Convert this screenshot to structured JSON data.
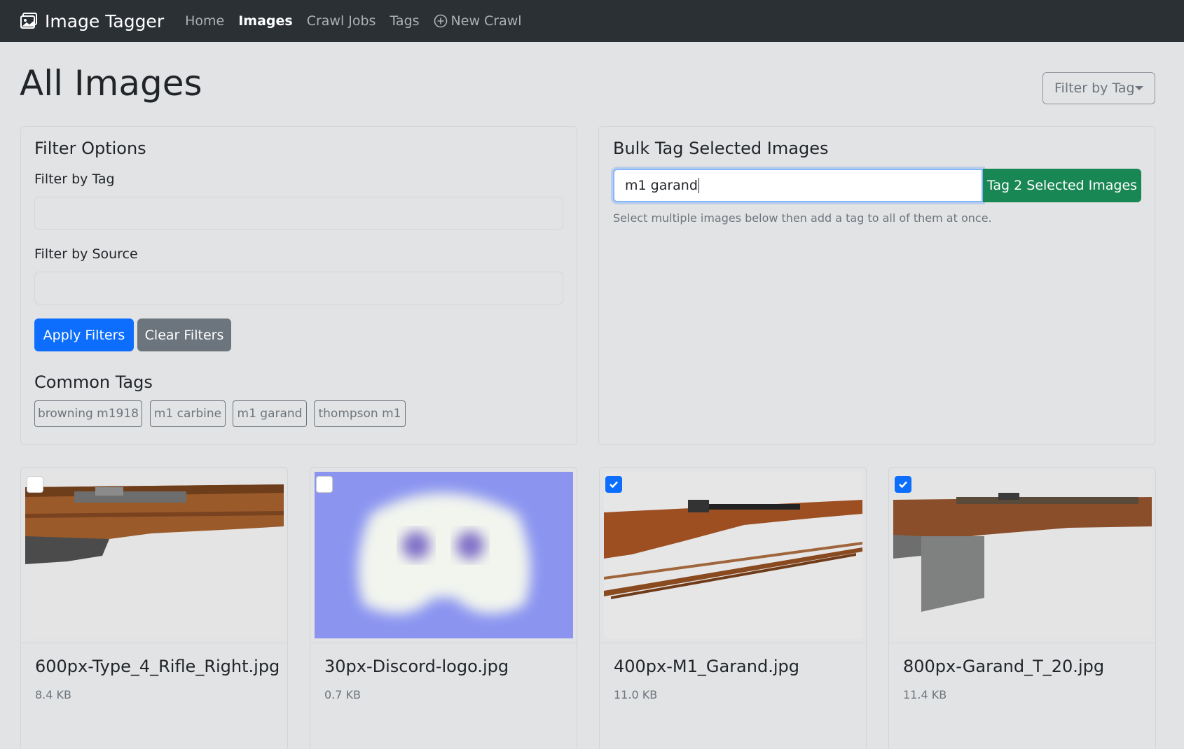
{
  "navbar": {
    "brand": "Image Tagger",
    "links": [
      "Home",
      "Images",
      "Crawl Jobs",
      "Tags"
    ],
    "new_crawl": "New Crawl"
  },
  "header": {
    "title": "All Images",
    "filter_dropdown": "Filter by Tag"
  },
  "filter_options": {
    "title": "Filter Options",
    "tag_label": "Filter by Tag",
    "tag_value": "",
    "source_label": "Filter by Source",
    "source_value": "",
    "apply_label": "Apply Filters",
    "clear_label": "Clear Filters",
    "common_tags_title": "Common Tags",
    "common_tags": [
      "browning m1918",
      "m1 carbine",
      "m1 garand",
      "thompson m1"
    ]
  },
  "bulk_tag": {
    "title": "Bulk Tag Selected Images",
    "input_value": "m1 garand",
    "button_label": "Tag 2 Selected Images",
    "helper_text": "Select multiple images below then add a tag to all of them at once."
  },
  "images": [
    {
      "filename": "600px-Type_4_Rifle_Right.jpg",
      "size": "8.4 KB",
      "selected": false
    },
    {
      "filename": "30px-Discord-logo.jpg",
      "size": "0.7 KB",
      "selected": false
    },
    {
      "filename": "400px-M1_Garand.jpg",
      "size": "11.0 KB",
      "selected": true
    },
    {
      "filename": "800px-Garand_T_20.jpg",
      "size": "11.4 KB",
      "selected": true
    }
  ],
  "colors": {
    "navbar": "#2b3035",
    "primary": "#0d6efd",
    "success": "#198754",
    "secondary": "#6c757d",
    "discord_bg": "#8b95f0"
  }
}
